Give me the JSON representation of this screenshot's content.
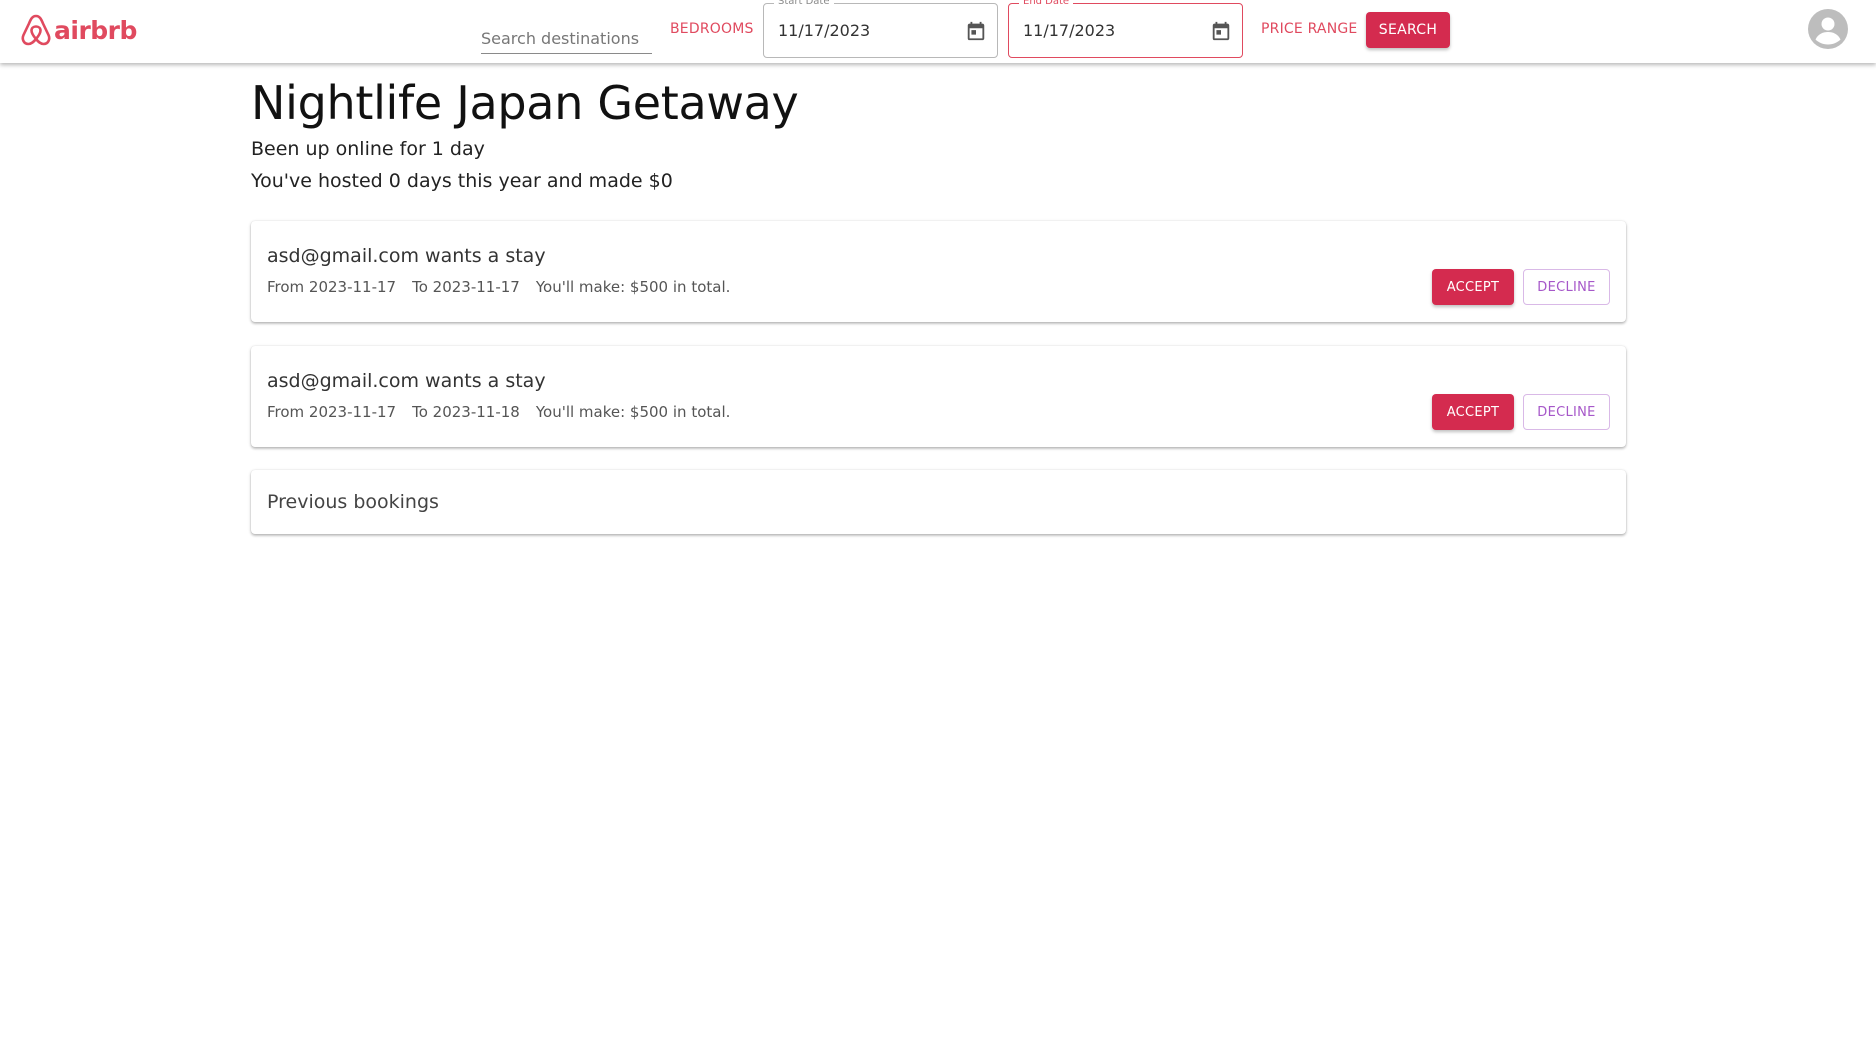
{
  "header": {
    "logo_text": "airbrb",
    "brand_color": "#e04a5f",
    "logo_icon": "airbnb-belo-icon",
    "search": {
      "placeholder": "Search destinations",
      "value": ""
    },
    "bedrooms_label": "BEDROOMS",
    "start_date": {
      "label": "Start Date",
      "value": "11/17/2023",
      "icon": "calendar-icon"
    },
    "end_date": {
      "label": "End Date",
      "value": "11/17/2023",
      "icon": "calendar-icon"
    },
    "price_range_label": "PRICE RANGE",
    "search_button_label": "SEARCH",
    "avatar_icon": "account-circle-icon"
  },
  "listing": {
    "title": "Nightlife Japan Getaway",
    "online_text": "Been up online for 1 day",
    "hosted_text": "You've hosted 0 days this year and made $0"
  },
  "requests": [
    {
      "title": "asd@gmail.com wants a stay",
      "from": "From 2023-11-17",
      "to": "To 2023-11-17",
      "earnings": "You'll make: $500 in total.",
      "accept_label": "ACCEPT",
      "decline_label": "DECLINE"
    },
    {
      "title": "asd@gmail.com wants a stay",
      "from": "From 2023-11-17",
      "to": "To 2023-11-18",
      "earnings": "You'll make: $500 in total.",
      "accept_label": "ACCEPT",
      "decline_label": "DECLINE"
    }
  ],
  "previous_bookings": {
    "title": "Previous bookings"
  },
  "colors": {
    "accent": "#d42b4f",
    "decline_text": "#a657c9"
  }
}
